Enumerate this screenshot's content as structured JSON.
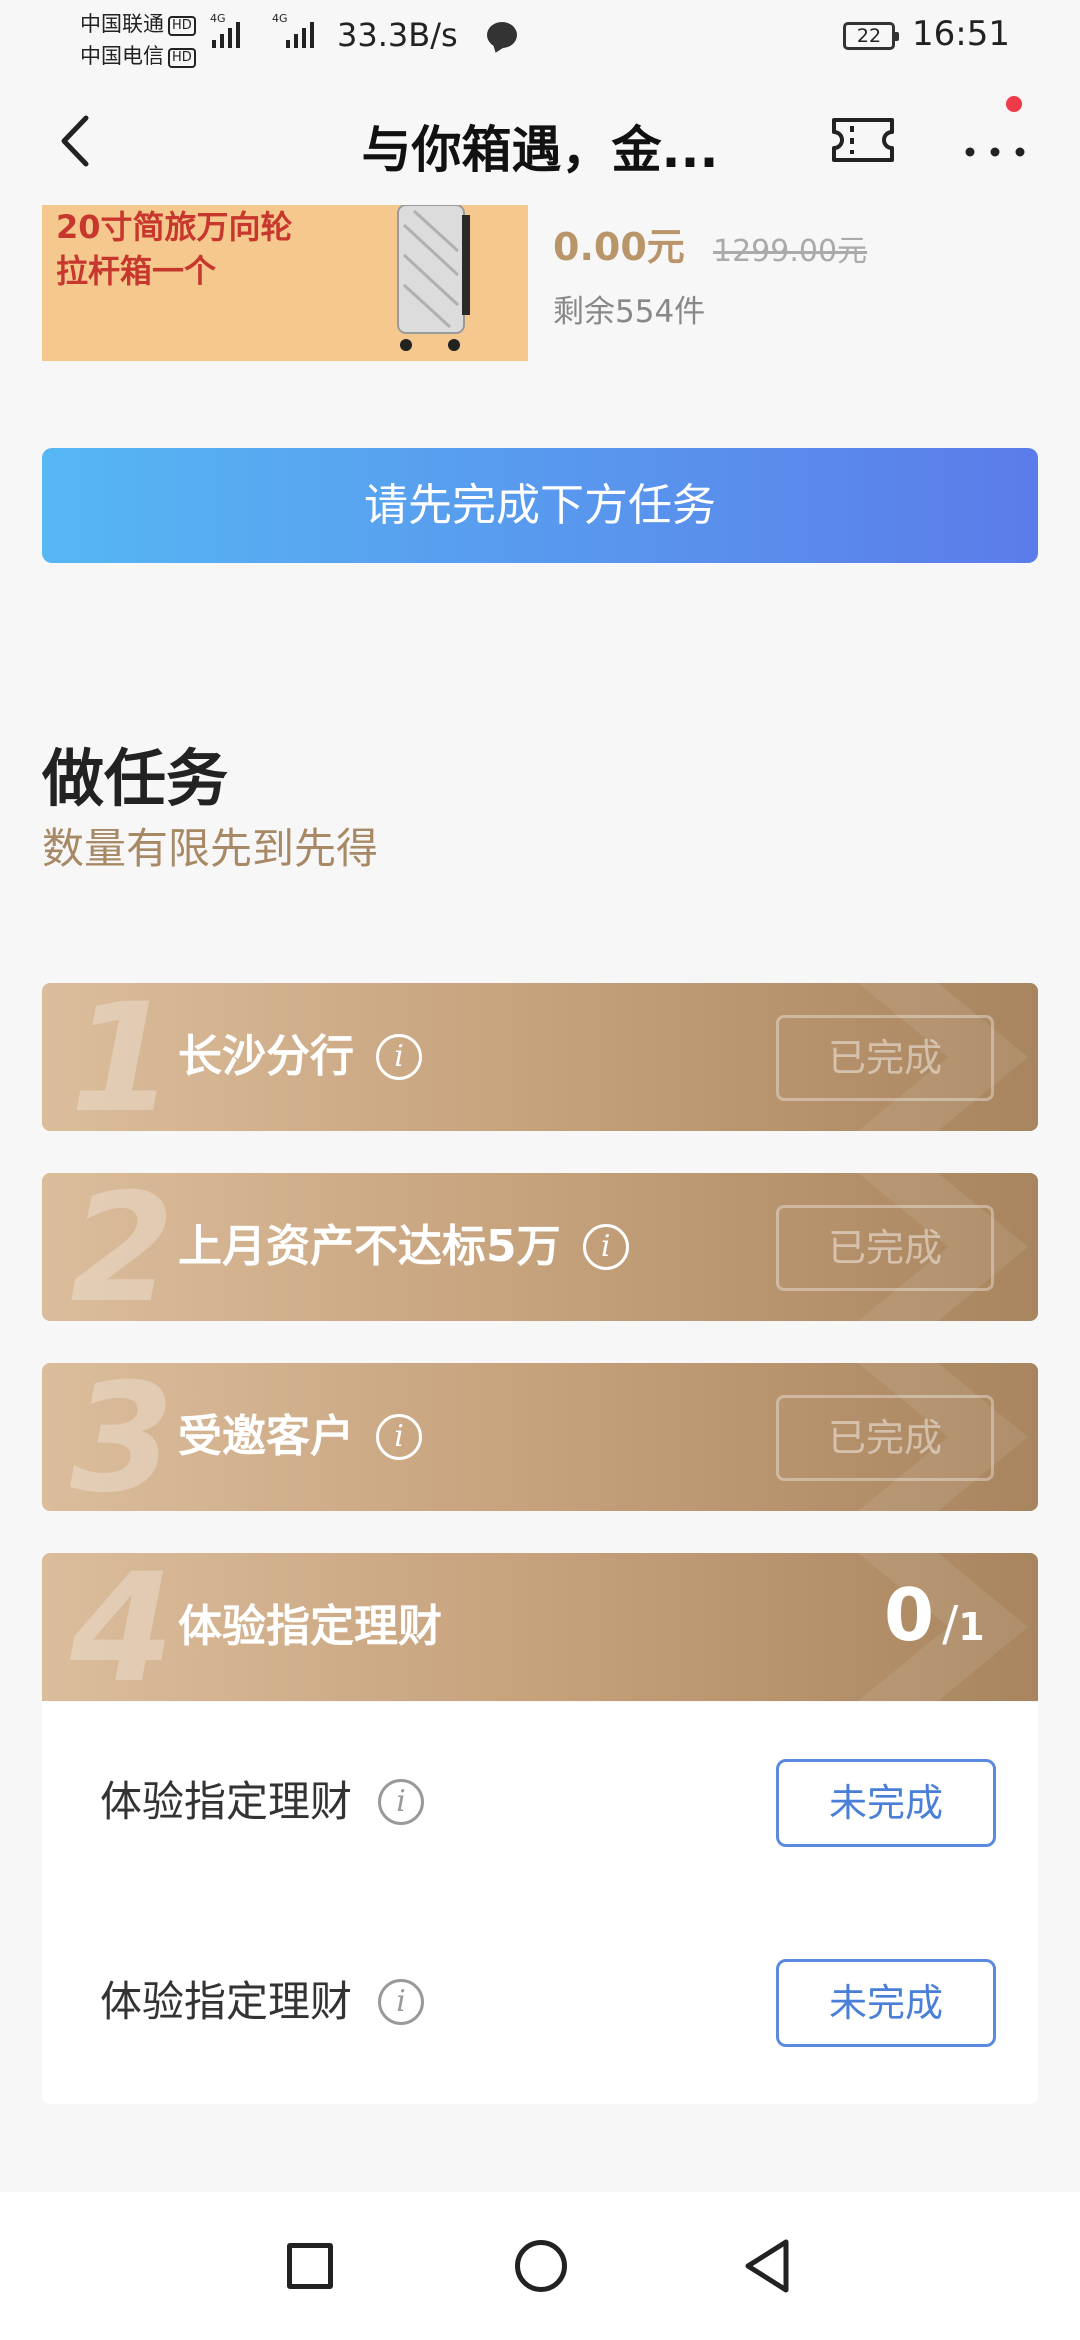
{
  "status_bar": {
    "carrier1": "中国联通",
    "carrier2": "中国电信",
    "hd": "HD",
    "network1": "4G",
    "network2": "4G",
    "net_speed": "33.3B/s",
    "battery": "22",
    "time": "16:51"
  },
  "header": {
    "title": "与你箱遇，金..."
  },
  "product": {
    "banner_line1": "20寸简旅万向轮",
    "banner_line2": "拉杆箱一个",
    "price_now": "0.00元",
    "price_original": "1299.00元",
    "stock": "剩余554件"
  },
  "main_button": "请先完成下方任务",
  "section": {
    "title": "做任务",
    "subtitle": "数量有限先到先得"
  },
  "tasks": [
    {
      "num": "1",
      "name": "长沙分行",
      "status": "已完成"
    },
    {
      "num": "2",
      "name": "上月资产不达标5万",
      "status": "已完成"
    },
    {
      "num": "3",
      "name": "受邀客户",
      "status": "已完成"
    },
    {
      "num": "4",
      "name": "体验指定理财",
      "progress_done": "0",
      "progress_slash": "/",
      "progress_total": "1"
    }
  ],
  "subtasks": [
    {
      "name": "体验指定理财",
      "status": "未完成"
    },
    {
      "name": "体验指定理财",
      "status": "未完成"
    }
  ],
  "icons": {
    "info": "i"
  },
  "colors": {
    "primary_gradient_start": "#56b7f3",
    "primary_gradient_end": "#5b7ce9",
    "task_gold": "#c8a47f",
    "price": "#b9956a",
    "banner_bg": "#f5c98e",
    "banner_text": "#c8372d",
    "todo_blue": "#4a7fd8"
  }
}
